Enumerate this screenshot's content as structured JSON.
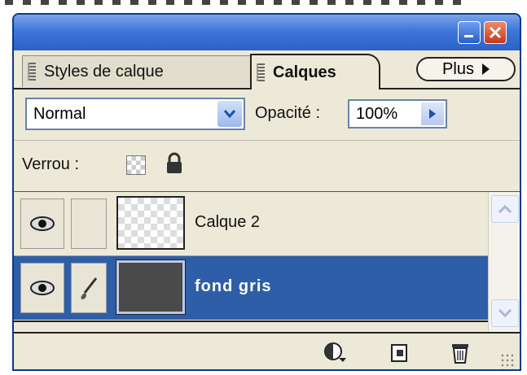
{
  "tabs": {
    "styles_label": "Styles de calque",
    "calques_label": "Calques",
    "plus_label": "Plus"
  },
  "controls": {
    "blend_mode": "Normal",
    "opacity_label": "Opacité :",
    "opacity_value": "100%",
    "lock_label": "Verrou :"
  },
  "layers": [
    {
      "name": "Calque 2",
      "visible": true,
      "selected": false,
      "thumbnail": "transparent"
    },
    {
      "name": "fond gris",
      "visible": true,
      "selected": true,
      "thumbnail": "grey"
    }
  ],
  "icons": {
    "titlebar": [
      "minimize-icon",
      "close-icon"
    ],
    "locks": [
      "lock-transparency-icon",
      "lock-all-icon"
    ],
    "bottom": [
      "new-adjustment-layer-icon",
      "new-layer-icon",
      "trash-icon"
    ]
  },
  "colors": {
    "titlebar": "#3f76d9",
    "panel": "#ece9d8",
    "selection": "#2f5ea8"
  }
}
